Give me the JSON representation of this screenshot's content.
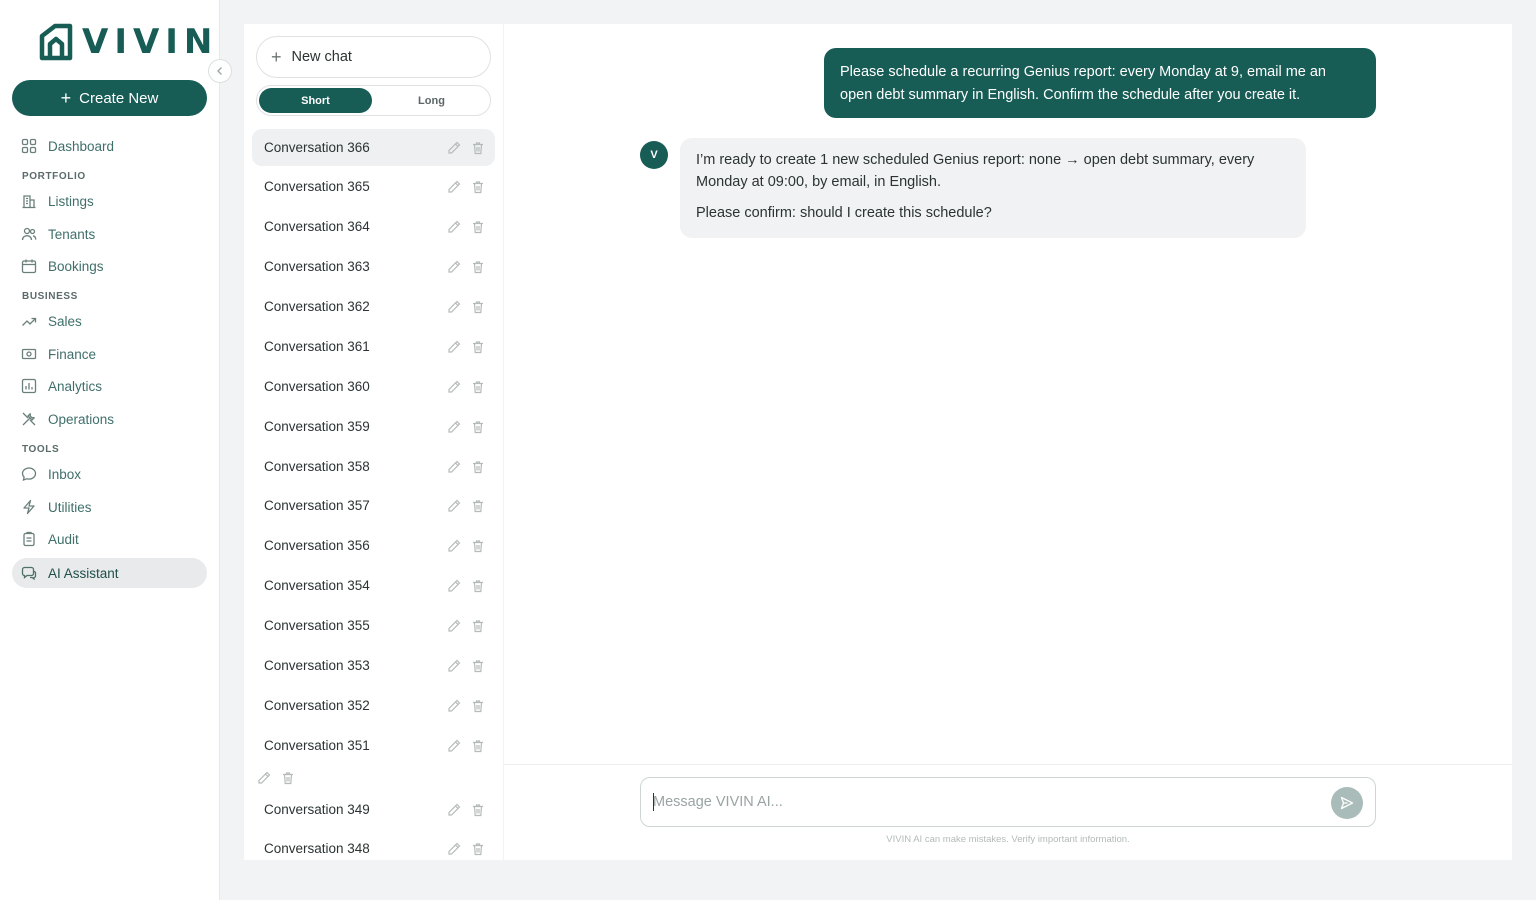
{
  "brand": {
    "name": "VIVIN",
    "accent": "#175c55"
  },
  "sidebar": {
    "create_label": "Create New",
    "sections": {
      "portfolio": "PORTFOLIO",
      "business": "BUSINESS",
      "tools": "TOOLS"
    },
    "items": [
      {
        "label": "Dashboard",
        "icon": "grid-icon"
      },
      {
        "label": "Listings",
        "icon": "building-icon"
      },
      {
        "label": "Tenants",
        "icon": "users-icon"
      },
      {
        "label": "Bookings",
        "icon": "calendar-icon"
      },
      {
        "label": "Sales",
        "icon": "trending-up-icon"
      },
      {
        "label": "Finance",
        "icon": "banknote-icon"
      },
      {
        "label": "Analytics",
        "icon": "bar-chart-icon"
      },
      {
        "label": "Operations",
        "icon": "tools-icon"
      },
      {
        "label": "Inbox",
        "icon": "message-icon"
      },
      {
        "label": "Utilities",
        "icon": "bolt-icon"
      },
      {
        "label": "Audit",
        "icon": "clipboard-icon"
      },
      {
        "label": "AI Assistant",
        "icon": "chat-bubbles-icon",
        "active": true
      }
    ]
  },
  "conversations": {
    "new_chat_label": "New chat",
    "length_toggle": {
      "short": "Short",
      "long": "Long",
      "selected": "Short"
    },
    "items": [
      "Conversation 366",
      "Conversation 365",
      "Conversation 364",
      "Conversation 363",
      "Conversation 362",
      "Conversation 361",
      "Conversation 360",
      "Conversation 359",
      "Conversation 358",
      "Conversation 357",
      "Conversation 356",
      "Conversation 354",
      "Conversation 355",
      "Conversation 353",
      "Conversation 352",
      "Conversation 351",
      "",
      "Conversation 349",
      "Conversation 348"
    ],
    "active_index": 0
  },
  "chat": {
    "user_message": "Please schedule a recurring Genius report: every Monday at 9, email me an open debt summary in English. Confirm the schedule after you create it.",
    "assistant_avatar": "V",
    "assistant_message": {
      "line1": "I’m ready to create 1 new scheduled Genius report: none → open debt summary, every Monday at 09:00, by email, in English.",
      "line2": "Please confirm: should I create this schedule?"
    },
    "composer": {
      "placeholder": "Message VIVIN AI...",
      "value": ""
    },
    "disclaimer": "VIVIN AI can make mistakes. Verify important information."
  }
}
